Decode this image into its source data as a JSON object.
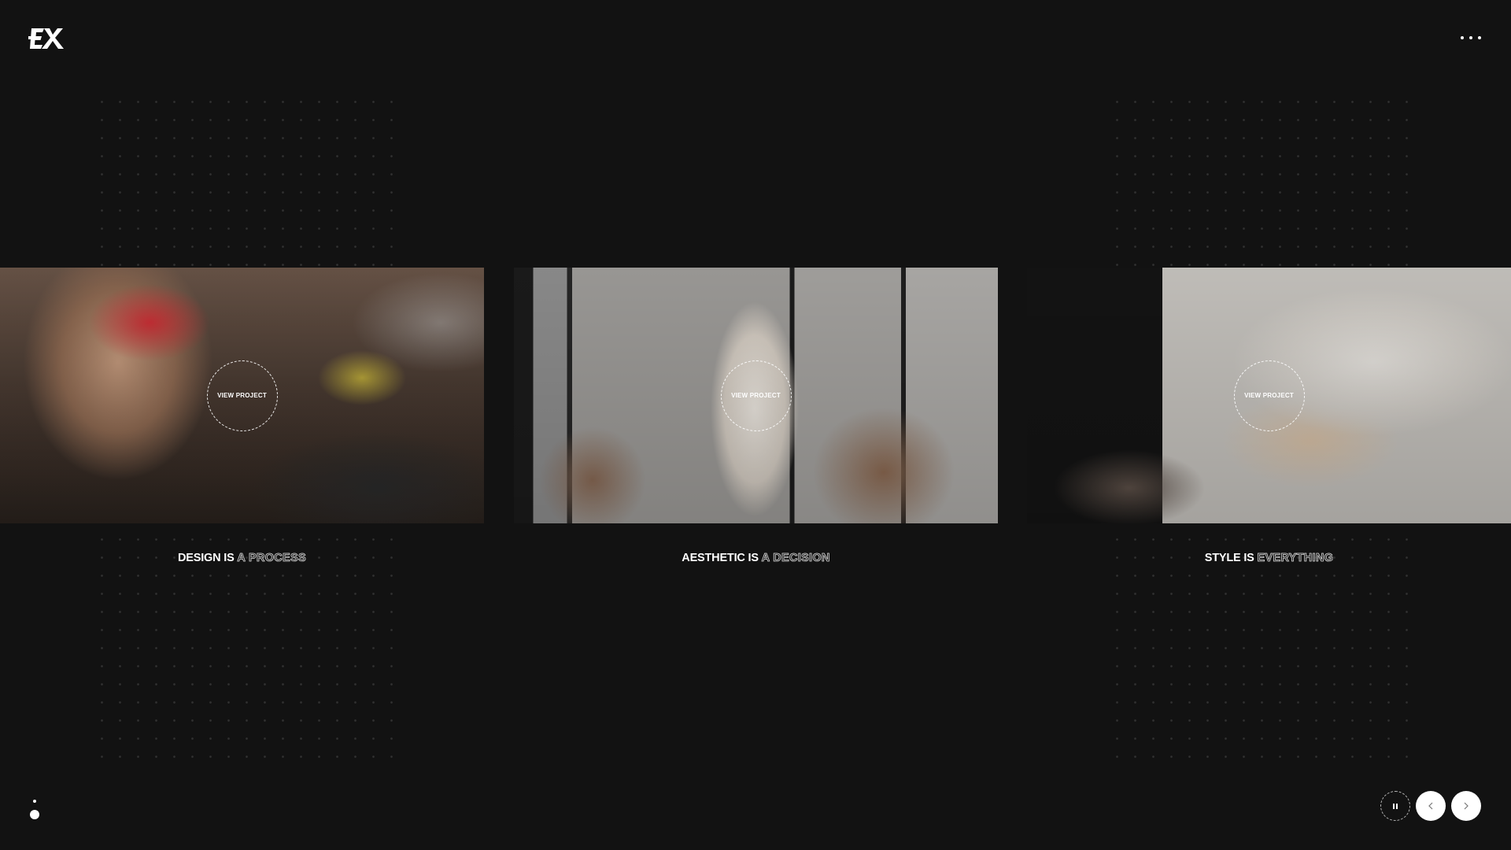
{
  "brand": {
    "logo_text": "EX",
    "logo_icon": "ex-logo-icon"
  },
  "header": {
    "menu_icon": "more-horizontal-icon"
  },
  "slides": [
    {
      "view_label": "VIEW PROJECT",
      "caption_solid": "DESIGN IS",
      "caption_outline": "A PROCESS"
    },
    {
      "view_label": "VIEW PROJECT",
      "caption_solid": "AESTHETIC IS",
      "caption_outline": "A DECISION"
    },
    {
      "view_label": "VIEW PROJECT",
      "caption_solid": "STYLE IS",
      "caption_outline": "EVERYTHING"
    }
  ],
  "pagination": {
    "active_index": 1,
    "total": 2
  },
  "controls": {
    "pause_icon": "pause-icon",
    "prev_icon": "chevron-left-icon",
    "next_icon": "chevron-right-icon"
  }
}
